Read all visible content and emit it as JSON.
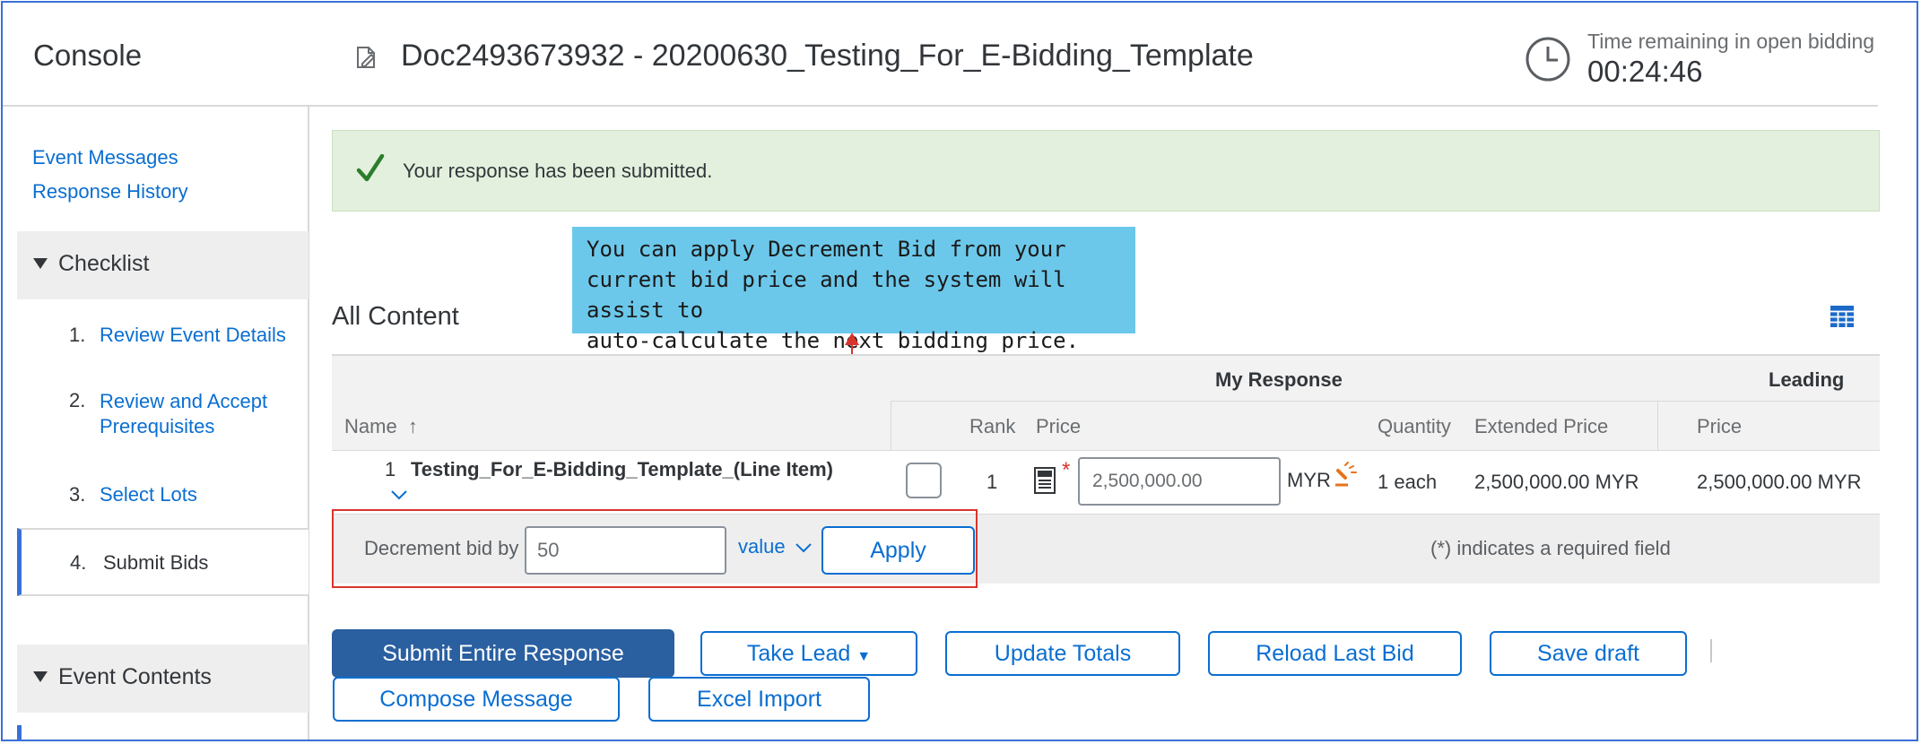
{
  "header": {
    "console": "Console",
    "doc_title": "Doc2493673932 - 20200630_Testing_For_E-Bidding_Template",
    "time_label": "Time remaining in open bidding",
    "time_value": "00:24:46"
  },
  "sidebar": {
    "links": [
      "Event Messages",
      "Response History"
    ],
    "checklist_title": "Checklist",
    "steps": [
      {
        "num": "1.",
        "label": "Review Event Details"
      },
      {
        "num": "2.",
        "label_line1": "Review and Accept",
        "label_line2": "Prerequisites"
      },
      {
        "num": "3.",
        "label": "Select Lots"
      },
      {
        "num": "4.",
        "label": "Submit Bids"
      }
    ],
    "event_contents_title": "Event Contents"
  },
  "notification": {
    "message": "Your response has been submitted."
  },
  "callout": {
    "line1": "You can apply Decrement Bid from your",
    "line2": "current bid price and the system will assist to",
    "line3": "auto-calculate the next bidding price."
  },
  "content": {
    "title": "All Content",
    "group_my_response": "My Response",
    "group_leading": "Leading",
    "columns": {
      "name": "Name",
      "rank": "Rank",
      "price": "Price",
      "quantity": "Quantity",
      "extended_price": "Extended Price",
      "leading_price": "Price"
    },
    "row": {
      "index": "1",
      "name": "Testing_For_E-Bidding_Template_(Line Item)",
      "rank": "1",
      "required_mark": "*",
      "price_value": "2,500,000.00",
      "currency": "MYR",
      "quantity": "1 each",
      "extended_price": "2,500,000.00 MYR",
      "leading_price": "2,500,000.00 MYR"
    }
  },
  "decrement": {
    "label": "Decrement bid by",
    "value": "50",
    "mode": "value",
    "apply": "Apply",
    "required_note": "(*) indicates a required field"
  },
  "actions": {
    "submit": "Submit Entire Response",
    "take_lead": "Take Lead",
    "update_totals": "Update Totals",
    "reload_last_bid": "Reload Last Bid",
    "save_draft": "Save draft",
    "compose_message": "Compose Message",
    "excel_import": "Excel Import"
  },
  "colors": {
    "link": "#0a6ed1",
    "success_bg": "#e3f0dd",
    "callout_bg": "#6cc8ea",
    "annotation_red": "#d9342b",
    "primary_button": "#2a5fa0",
    "auction_icon": "#e8731c"
  }
}
